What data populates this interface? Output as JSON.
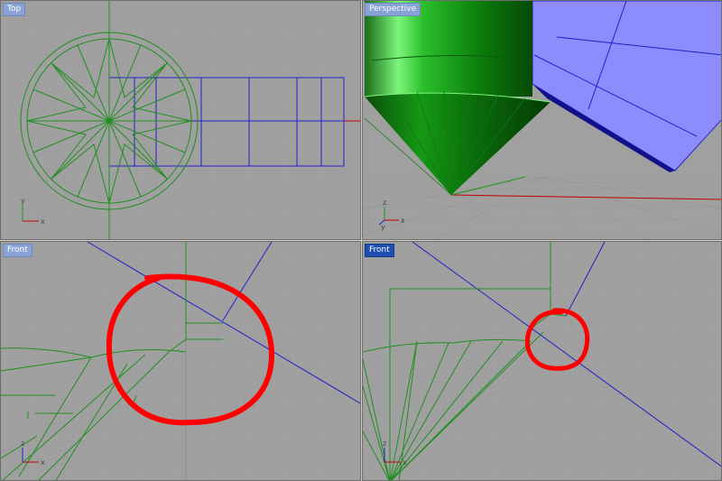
{
  "viewports": {
    "top_left": {
      "label": "Top",
      "active": false,
      "axes": [
        "y",
        "x"
      ]
    },
    "top_right": {
      "label": "Perspective",
      "active": false,
      "axes": [
        "z",
        "y",
        "x"
      ]
    },
    "bottom_left": {
      "label": "Front",
      "active": false,
      "axes": [
        "z",
        "x"
      ]
    },
    "bottom_right": {
      "label": "Front",
      "active": true,
      "axes": [
        "z",
        "x"
      ]
    }
  },
  "colors": {
    "background": "#a0a0a0",
    "grid": "#969696",
    "grid_major": "#8a8a8a",
    "green_geometry": "#1f8f1f",
    "blue_geometry": "#2020c8",
    "blue_surface": "#8c8cff",
    "annotation": "#ff0000",
    "axis_x": "#c00000",
    "axis_y": "#1a9a1a",
    "label_bg": "#8aa3d6",
    "label_bg_active": "#1f4fb0"
  },
  "icons": [
    "axis-triad-icon"
  ]
}
